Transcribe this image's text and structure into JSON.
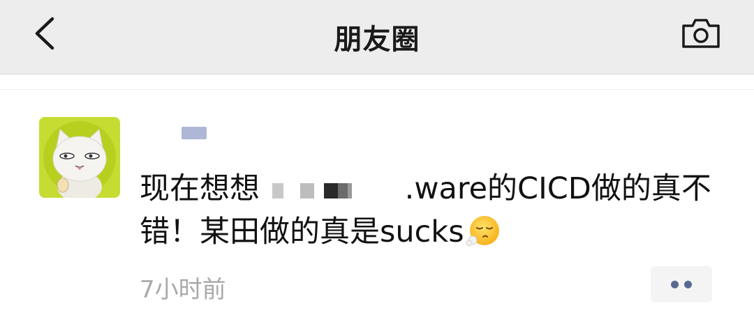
{
  "header": {
    "title": "朋友圈",
    "back_icon": "chevron-left-icon",
    "camera_icon": "camera-icon"
  },
  "post": {
    "avatar_icon": "cartoon-cat-avatar",
    "text_part1": "现在想想",
    "text_part2": ".ware的CICD做的真不错！某田做的真是sucks",
    "emoji_icon": "sighing-face-emoji",
    "timestamp": "7小时前",
    "more_icon": "more-dots-icon"
  },
  "colors": {
    "nav_bg": "#ededed",
    "link_blue": "#57698f",
    "timestamp_gray": "#a9a9a9",
    "avatar_bg": "#c6dc33"
  }
}
